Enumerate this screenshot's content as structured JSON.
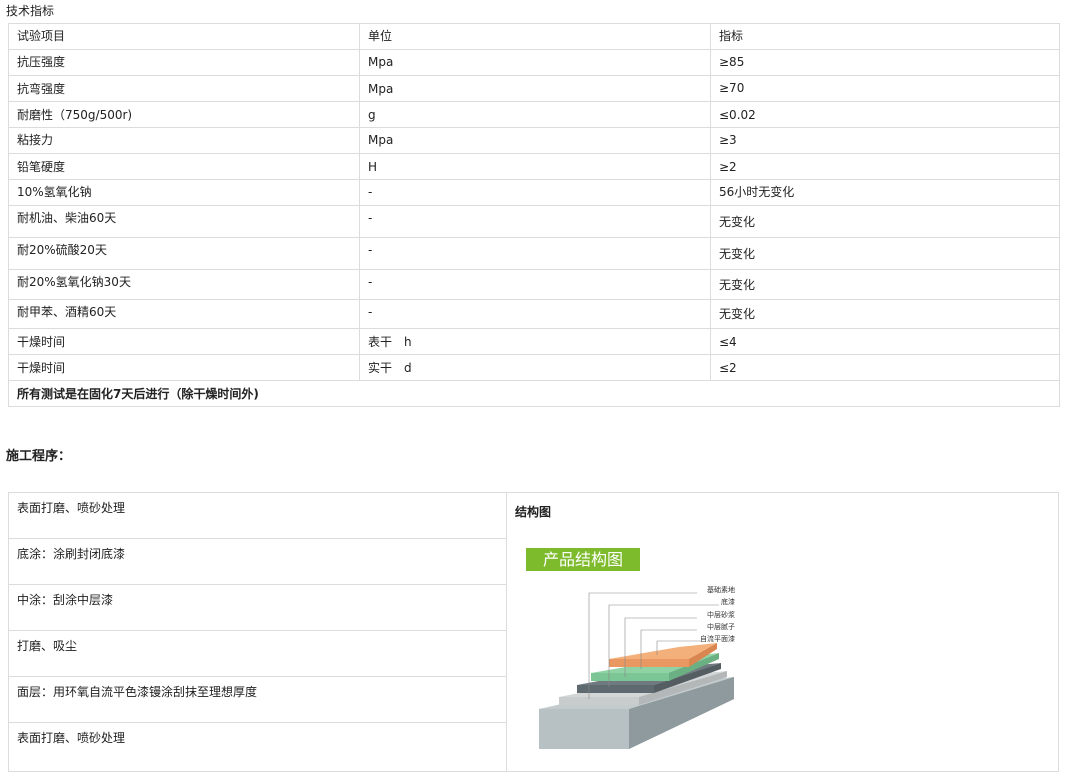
{
  "spec_section": {
    "title": "技术指标",
    "headers": [
      "试验项目",
      "单位",
      "指标"
    ],
    "rows": [
      [
        "抗压强度",
        "Mpa",
        "≥85"
      ],
      [
        "抗弯强度",
        "Mpa",
        "≥70"
      ],
      [
        "耐磨性（750g/500r)",
        "g",
        "≤0.02"
      ],
      [
        "粘接力",
        "Mpa",
        "≥3"
      ],
      [
        "铅笔硬度",
        "H",
        "≥2"
      ],
      [
        "10%氢氧化钠",
        "-",
        "56小时无变化"
      ],
      [
        "耐机油、柴油60天",
        "-",
        "无变化"
      ],
      [
        "耐20%硫酸20天",
        "-",
        "无变化"
      ],
      [
        "耐20%氢氧化钠30天",
        "-",
        "无变化"
      ],
      [
        "耐甲苯、酒精60天",
        "-",
        "无变化"
      ],
      [
        "干燥时间",
        "表干　h",
        "≤4"
      ],
      [
        "干燥时间",
        "实干　d",
        "≤2"
      ]
    ],
    "note": "所有测试是在固化7天后进行（除干燥时间外)"
  },
  "procedure": {
    "title": "施工程序：",
    "steps": [
      "表面打磨、喷砂处理",
      "底涂：涂刷封闭底漆",
      "中涂：刮涂中层漆",
      "打磨、吸尘",
      "面层：用环氧自流平色漆镘涂刮抹至理想厚度",
      "表面打磨、喷砂处理"
    ],
    "structure_label": "结构图",
    "diagram": {
      "banner": "产品结构图",
      "layers": [
        "基础素地",
        "底漆",
        "中层砂浆",
        "中层腻子",
        "自流平面漆"
      ],
      "colors": {
        "banner": "#7dbb2c",
        "concrete": "#a9b4b8",
        "primer": "#6e7a80",
        "mortar": "#c9cccc",
        "putty": "#8fd3a5",
        "topcoat": "#f4b07a"
      }
    }
  }
}
